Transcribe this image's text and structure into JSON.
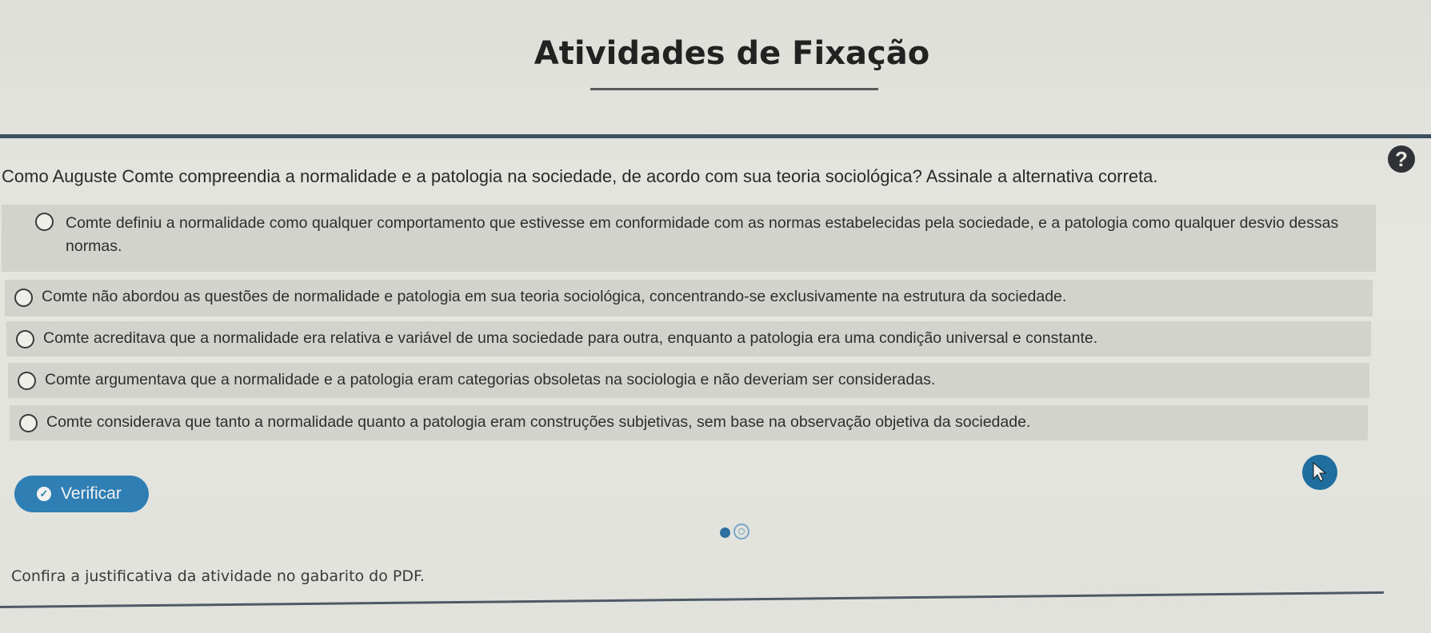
{
  "header": {
    "title": "Atividades de Fixação"
  },
  "help": {
    "icon": "help-circle-icon",
    "symbol": "?"
  },
  "question": {
    "text": "Como Auguste Comte compreendia a normalidade e a patologia na sociedade, de acordo com sua teoria sociológica? Assinale a alternativa correta."
  },
  "options": [
    {
      "text": "Comte definiu a normalidade como qualquer comportamento que estivesse em conformidade com as normas estabelecidas pela sociedade, e a patologia como qualquer desvio dessas normas.",
      "selected": false
    },
    {
      "text": "Comte não abordou as questões de normalidade e patologia em sua teoria sociológica, concentrando-se exclusivamente na estrutura da sociedade.",
      "selected": false
    },
    {
      "text": "Comte acreditava que a normalidade era relativa e variável de uma sociedade para outra, enquanto a patologia era uma condição universal e constante.",
      "selected": false
    },
    {
      "text": "Comte argumentava que a normalidade e a patologia eram categorias obsoletas na sociologia e não deveriam ser consideradas.",
      "selected": false
    },
    {
      "text": "Comte considerava que tanto a normalidade quanto a patologia eram construções subjetivas, sem base na observação objetiva da sociedade.",
      "selected": false
    }
  ],
  "verify_button": {
    "label": "Verificar",
    "icon": "check-circle-icon"
  },
  "pager": {
    "current": 1,
    "total": 2
  },
  "footer": {
    "note": "Confira a justificativa da atividade no gabarito do PDF."
  },
  "colors": {
    "accent": "#2f7fb5",
    "option_bg": "#d3d3cd",
    "rule": "#3f4e5e"
  }
}
